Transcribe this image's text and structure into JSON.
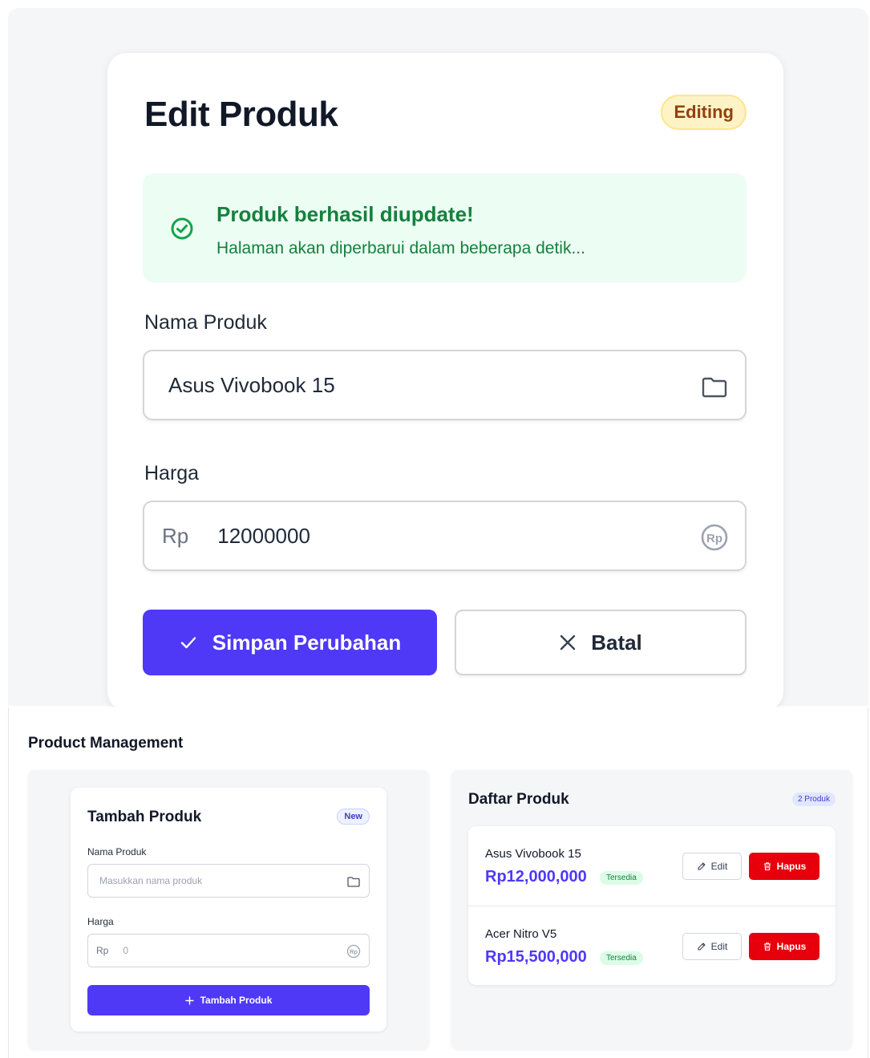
{
  "edit_panel": {
    "title": "Edit Produk",
    "status_badge": "Editing",
    "alert": {
      "title": "Produk berhasil diupdate!",
      "message": "Halaman akan diperbarui dalam beberapa detik..."
    },
    "name_label": "Nama Produk",
    "name_value": "Asus Vivobook 15",
    "price_label": "Harga",
    "price_prefix": "Rp",
    "price_value": "12000000",
    "save_label": "Simpan Perubahan",
    "cancel_label": "Batal"
  },
  "page": {
    "title": "Product Management"
  },
  "add_form": {
    "title": "Tambah Produk",
    "badge": "New",
    "name_label": "Nama Produk",
    "name_placeholder": "Masukkan nama produk",
    "price_label": "Harga",
    "price_prefix": "Rp",
    "price_placeholder": "0",
    "submit_label": "Tambah Produk"
  },
  "product_list": {
    "title": "Daftar Produk",
    "count_badge": "2 Produk",
    "items": [
      {
        "name": "Asus Vivobook 15",
        "price": "Rp12,000,000",
        "status": "Tersedia",
        "edit_label": "Edit",
        "delete_label": "Hapus"
      },
      {
        "name": "Acer Nitro V5",
        "price": "Rp15,500,000",
        "status": "Tersedia",
        "edit_label": "Edit",
        "delete_label": "Hapus"
      }
    ]
  },
  "colors": {
    "primary": "#4f39f6",
    "danger": "#e7000b",
    "success": "#15803d",
    "warning_badge": "#fef3c7"
  },
  "icons": {
    "success": "check-circle-icon",
    "name_field": "folder-icon",
    "price_field": "rupiah-icon",
    "save": "check-icon",
    "cancel": "x-icon",
    "add": "plus-icon",
    "edit": "pencil-icon",
    "delete": "trash-icon"
  }
}
